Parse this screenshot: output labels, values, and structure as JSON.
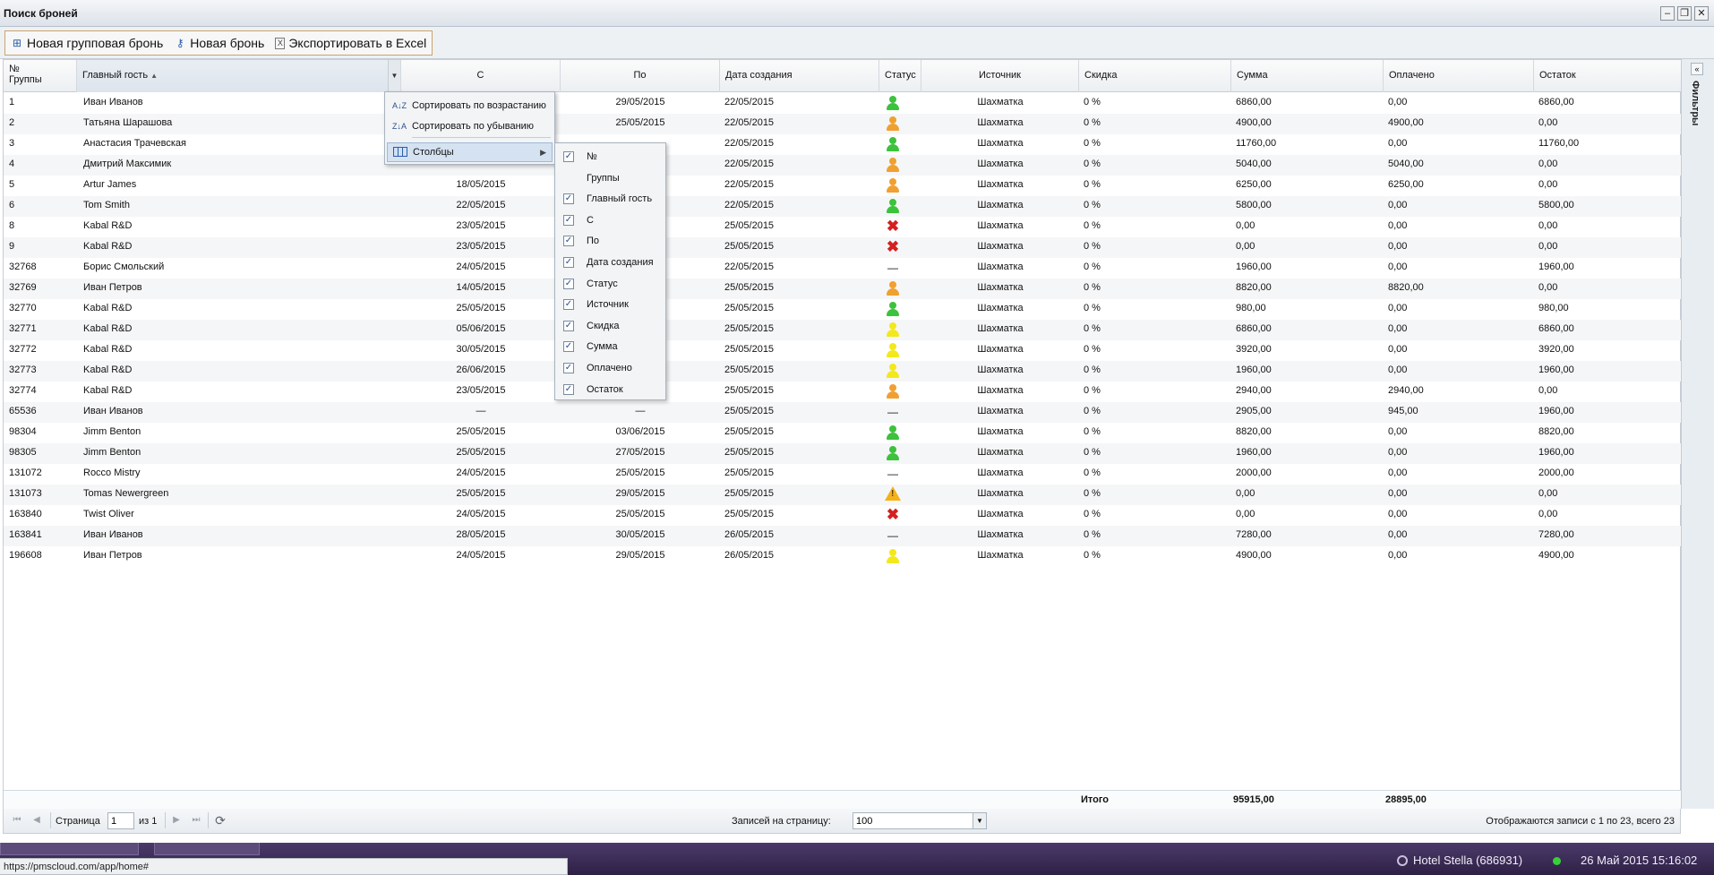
{
  "window": {
    "title": "Поиск броней"
  },
  "toolbar": {
    "new_group_booking": "Новая групповая бронь",
    "new_booking": "Новая бронь",
    "export_excel": "Экспортировать в Excel"
  },
  "columns": {
    "num": "№",
    "groups": "Группы",
    "main_guest": "Главный гость",
    "from": "С",
    "to": "По",
    "created": "Дата создания",
    "status": "Статус",
    "source": "Источник",
    "discount": "Скидка",
    "sum": "Сумма",
    "paid": "Оплачено",
    "rest": "Остаток"
  },
  "rows": [
    {
      "num": "1",
      "guest": "Иван Иванов",
      "from": "",
      "to": "29/05/2015",
      "created": "22/05/2015",
      "status": "green",
      "source": "Шахматка",
      "discount": "0 %",
      "sum": "6860,00",
      "paid": "0,00",
      "rest": "6860,00"
    },
    {
      "num": "2",
      "guest": "Татьяна Шарашова",
      "from": "",
      "to": "25/05/2015",
      "created": "22/05/2015",
      "status": "orange",
      "source": "Шахматка",
      "discount": "0 %",
      "sum": "4900,00",
      "paid": "4900,00",
      "rest": "0,00"
    },
    {
      "num": "3",
      "guest": "Анастасия Трачевская",
      "from": "",
      "to": "",
      "created": "22/05/2015",
      "status": "green",
      "source": "Шахматка",
      "discount": "0 %",
      "sum": "11760,00",
      "paid": "0,00",
      "rest": "11760,00"
    },
    {
      "num": "4",
      "guest": "Дмитрий Максимик",
      "from": "",
      "to": "",
      "created": "22/05/2015",
      "status": "orange",
      "source": "Шахматка",
      "discount": "0 %",
      "sum": "5040,00",
      "paid": "5040,00",
      "rest": "0,00"
    },
    {
      "num": "5",
      "guest": "Artur James",
      "from": "18/05/2015",
      "to": "",
      "created": "22/05/2015",
      "status": "orange",
      "source": "Шахматка",
      "discount": "0 %",
      "sum": "6250,00",
      "paid": "6250,00",
      "rest": "0,00"
    },
    {
      "num": "6",
      "guest": "Tom Smith",
      "from": "22/05/2015",
      "to": "",
      "created": "22/05/2015",
      "status": "green",
      "source": "Шахматка",
      "discount": "0 %",
      "sum": "5800,00",
      "paid": "0,00",
      "rest": "5800,00"
    },
    {
      "num": "8",
      "guest": "Kabal R&D",
      "from": "23/05/2015",
      "to": "",
      "created": "25/05/2015",
      "status": "cross",
      "source": "Шахматка",
      "discount": "0 %",
      "sum": "0,00",
      "paid": "0,00",
      "rest": "0,00"
    },
    {
      "num": "9",
      "guest": "Kabal R&D",
      "from": "23/05/2015",
      "to": "",
      "created": "25/05/2015",
      "status": "cross",
      "source": "Шахматка",
      "discount": "0 %",
      "sum": "0,00",
      "paid": "0,00",
      "rest": "0,00"
    },
    {
      "num": "32768",
      "guest": "Борис Смольский",
      "from": "24/05/2015",
      "to": "",
      "created": "22/05/2015",
      "status": "dash",
      "source": "Шахматка",
      "discount": "0 %",
      "sum": "1960,00",
      "paid": "0,00",
      "rest": "1960,00"
    },
    {
      "num": "32769",
      "guest": "Иван Петров",
      "from": "14/05/2015",
      "to": "",
      "created": "25/05/2015",
      "status": "orange",
      "source": "Шахматка",
      "discount": "0 %",
      "sum": "8820,00",
      "paid": "8820,00",
      "rest": "0,00"
    },
    {
      "num": "32770",
      "guest": "Kabal R&D",
      "from": "25/05/2015",
      "to": "",
      "created": "25/05/2015",
      "status": "green",
      "source": "Шахматка",
      "discount": "0 %",
      "sum": "980,00",
      "paid": "0,00",
      "rest": "980,00"
    },
    {
      "num": "32771",
      "guest": "Kabal R&D",
      "from": "05/06/2015",
      "to": "",
      "created": "25/05/2015",
      "status": "yellow",
      "source": "Шахматка",
      "discount": "0 %",
      "sum": "6860,00",
      "paid": "0,00",
      "rest": "6860,00"
    },
    {
      "num": "32772",
      "guest": "Kabal R&D",
      "from": "30/05/2015",
      "to": "",
      "created": "25/05/2015",
      "status": "yellow",
      "source": "Шахматка",
      "discount": "0 %",
      "sum": "3920,00",
      "paid": "0,00",
      "rest": "3920,00"
    },
    {
      "num": "32773",
      "guest": "Kabal R&D",
      "from": "26/06/2015",
      "to": "",
      "created": "25/05/2015",
      "status": "yellow",
      "source": "Шахматка",
      "discount": "0 %",
      "sum": "1960,00",
      "paid": "0,00",
      "rest": "1960,00"
    },
    {
      "num": "32774",
      "guest": "Kabal R&D",
      "from": "23/05/2015",
      "to": "",
      "created": "25/05/2015",
      "status": "orange",
      "source": "Шахматка",
      "discount": "0 %",
      "sum": "2940,00",
      "paid": "2940,00",
      "rest": "0,00"
    },
    {
      "num": "65536",
      "guest": "Иван Иванов",
      "from": "—",
      "to": "—",
      "created": "25/05/2015",
      "status": "dash",
      "source": "Шахматка",
      "discount": "0 %",
      "sum": "2905,00",
      "paid": "945,00",
      "rest": "1960,00"
    },
    {
      "num": "98304",
      "guest": "Jimm Benton",
      "from": "25/05/2015",
      "to": "03/06/2015",
      "created": "25/05/2015",
      "status": "green",
      "source": "Шахматка",
      "discount": "0 %",
      "sum": "8820,00",
      "paid": "0,00",
      "rest": "8820,00"
    },
    {
      "num": "98305",
      "guest": "Jimm Benton",
      "from": "25/05/2015",
      "to": "27/05/2015",
      "created": "25/05/2015",
      "status": "green",
      "source": "Шахматка",
      "discount": "0 %",
      "sum": "1960,00",
      "paid": "0,00",
      "rest": "1960,00"
    },
    {
      "num": "131072",
      "guest": "Rocco Mistry",
      "from": "24/05/2015",
      "to": "25/05/2015",
      "created": "25/05/2015",
      "status": "dash",
      "source": "Шахматка",
      "discount": "0 %",
      "sum": "2000,00",
      "paid": "0,00",
      "rest": "2000,00"
    },
    {
      "num": "131073",
      "guest": "Tomas Newergreen",
      "from": "25/05/2015",
      "to": "29/05/2015",
      "created": "25/05/2015",
      "status": "warn",
      "source": "Шахматка",
      "discount": "0 %",
      "sum": "0,00",
      "paid": "0,00",
      "rest": "0,00"
    },
    {
      "num": "163840",
      "guest": "Twist Oliver",
      "from": "24/05/2015",
      "to": "25/05/2015",
      "created": "25/05/2015",
      "status": "cross",
      "source": "Шахматка",
      "discount": "0 %",
      "sum": "0,00",
      "paid": "0,00",
      "rest": "0,00"
    },
    {
      "num": "163841",
      "guest": "Иван Иванов",
      "from": "28/05/2015",
      "to": "30/05/2015",
      "created": "26/05/2015",
      "status": "dash",
      "source": "Шахматка",
      "discount": "0 %",
      "sum": "7280,00",
      "paid": "0,00",
      "rest": "7280,00"
    },
    {
      "num": "196608",
      "guest": "Иван Петров",
      "from": "24/05/2015",
      "to": "29/05/2015",
      "created": "26/05/2015",
      "status": "yellow",
      "source": "Шахматка",
      "discount": "0 %",
      "sum": "4900,00",
      "paid": "0,00",
      "rest": "4900,00"
    }
  ],
  "totals": {
    "label": "Итого",
    "sum": "95915,00",
    "paid": "28895,00"
  },
  "filters": {
    "label": "Фильтры"
  },
  "menu": {
    "sort_asc": "Сортировать по возрастанию",
    "sort_desc": "Сортировать по убыванию",
    "columns": "Столбцы"
  },
  "column_menu": [
    {
      "label": "№",
      "checked": true
    },
    {
      "label": "Группы",
      "checked": false
    },
    {
      "label": "Главный гость",
      "checked": true
    },
    {
      "label": "С",
      "checked": true
    },
    {
      "label": "По",
      "checked": true
    },
    {
      "label": "Дата создания",
      "checked": true
    },
    {
      "label": "Статус",
      "checked": true
    },
    {
      "label": "Источник",
      "checked": true
    },
    {
      "label": "Скидка",
      "checked": true
    },
    {
      "label": "Сумма",
      "checked": true
    },
    {
      "label": "Оплачено",
      "checked": true
    },
    {
      "label": "Остаток",
      "checked": true
    }
  ],
  "pager": {
    "page_label": "Страница",
    "page_value": "1",
    "of_label": "из 1",
    "per_page_label": "Записей на страницу:",
    "per_page_value": "100",
    "display_info": "Отображаются записи с 1 по 23, всего 23"
  },
  "taskbar": {
    "hotel": "Hotel Stella (686931)",
    "datetime": "26 Май 2015 15:16:02"
  },
  "status_url": "https://pmscloud.com/app/home#",
  "colors": {
    "status_green": "#3cc23c",
    "status_orange": "#f0a030",
    "status_yellow": "#f2e81c",
    "status_cross": "#d42020",
    "taskbar": "#3a2b55"
  }
}
